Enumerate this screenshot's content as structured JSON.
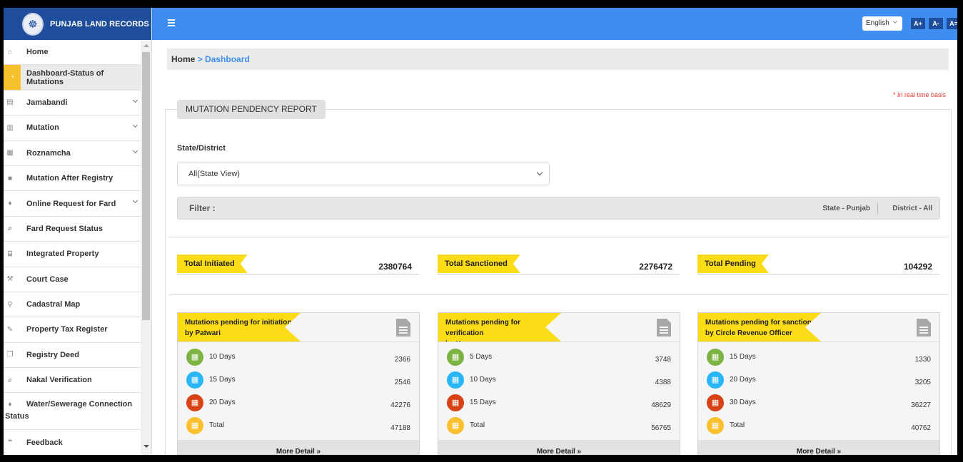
{
  "brand": {
    "title": "PUNJAB LAND RECORDS"
  },
  "sidebar": {
    "items": [
      {
        "label": "Home",
        "icon": "home-icon",
        "glyph": "⌂"
      },
      {
        "label": "Dashboard-Status of Mutations",
        "icon": "dashboard-icon",
        "glyph": "◔"
      },
      {
        "label": "Jamabandi",
        "icon": "id-card-icon",
        "glyph": "▤"
      },
      {
        "label": "Mutation",
        "icon": "file-icon",
        "glyph": "▥"
      },
      {
        "label": "Roznamcha",
        "icon": "book-icon",
        "glyph": "▦"
      },
      {
        "label": "Mutation After Registry",
        "icon": "briefcase-icon",
        "glyph": "■"
      },
      {
        "label": "Online Request for Fard",
        "icon": "drop-icon",
        "glyph": "♦"
      },
      {
        "label": "Fard Request Status",
        "icon": "search-icon",
        "glyph": "⌕"
      },
      {
        "label": "Integrated Property",
        "icon": "bank-icon",
        "glyph": "⌸"
      },
      {
        "label": "Court Case",
        "icon": "gavel-icon",
        "glyph": "⚒"
      },
      {
        "label": "Cadastral Map",
        "icon": "map-marker-icon",
        "glyph": "⚲"
      },
      {
        "label": "Property Tax Register",
        "icon": "edit-icon",
        "glyph": "✎"
      },
      {
        "label": "Registry Deed",
        "icon": "copy-icon",
        "glyph": "❐"
      },
      {
        "label": "Nakal Verification",
        "icon": "search-icon",
        "glyph": "⌕"
      },
      {
        "label": "Water/Sewerage Connection",
        "label2": "Status",
        "icon": "drop-icon",
        "glyph": "♦"
      },
      {
        "label": "Feedback",
        "icon": "comments-icon",
        "glyph": "❝"
      }
    ]
  },
  "header": {
    "language": "English",
    "font_increase": "A+",
    "font_decrease": "A-",
    "font_reset": "A="
  },
  "breadcrumb": {
    "home": "Home",
    "sep": ">",
    "current": "Dashboard"
  },
  "realtime_note": "* In real time basis",
  "report": {
    "tab": "MUTATION PENDENCY REPORT",
    "state_district_label": "State/District",
    "state_district_value": "All(State View)",
    "filter_label": "Filter :",
    "filter_state": "State - Punjab",
    "filter_district": "District - All"
  },
  "totals": [
    {
      "label": "Total Initiated",
      "value": "2380764"
    },
    {
      "label": "Total Sanctioned",
      "value": "2276472"
    },
    {
      "label": "Total Pending",
      "value": "104292"
    }
  ],
  "colors": {
    "green": "#7cb342",
    "blue": "#29b6f6",
    "red": "#d84315",
    "orange": "#fbc02d"
  },
  "cards": [
    {
      "title_line1": "Mutations pending for initiation",
      "title_line2": "by Patwari",
      "rows": [
        {
          "label": "10 Days",
          "value": "2366"
        },
        {
          "label": "15 Days",
          "value": "2546"
        },
        {
          "label": "20 Days",
          "value": "42276"
        },
        {
          "label": "Total",
          "value": "47188"
        }
      ],
      "more": "More Detail »"
    },
    {
      "title_line1": "Mutations pending for verification",
      "title_line2": "by Kanungo",
      "rows": [
        {
          "label": "5 Days",
          "value": "3748"
        },
        {
          "label": "10 Days",
          "value": "4388"
        },
        {
          "label": "15 Days",
          "value": "48629"
        },
        {
          "label": "Total",
          "value": "56765"
        }
      ],
      "more": "More Detail »"
    },
    {
      "title_line1": "Mutations pending for sanction",
      "title_line2": "by Circle Revenue Officer",
      "rows": [
        {
          "label": "15 Days",
          "value": "1330"
        },
        {
          "label": "20 Days",
          "value": "3205"
        },
        {
          "label": "30 Days",
          "value": "36227"
        },
        {
          "label": "Total",
          "value": "40762"
        }
      ],
      "more": "More Detail »"
    }
  ]
}
